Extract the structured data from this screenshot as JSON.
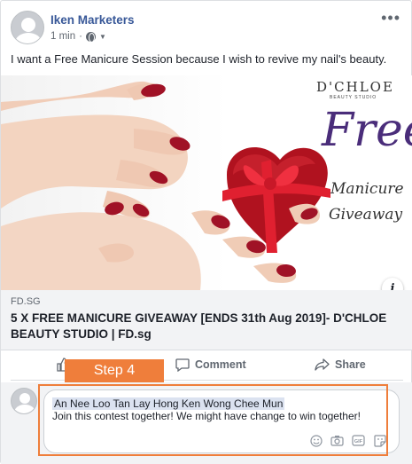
{
  "post": {
    "author": "Iken Marketers",
    "time": "1 min",
    "text": "I want a Free Manicure Session because I wish to revive my nail's beauty."
  },
  "image": {
    "brand": "D'CHLOE",
    "brand_sub": "BEAUTY STUDIO",
    "headline": "Free",
    "line1": "Manicure",
    "line2": "Giveaway",
    "info": "i"
  },
  "link": {
    "domain": "FD.SG",
    "title": "5 X FREE MANICURE GIVEAWAY [ENDS 31th Aug 2019]- D'CHLOE BEAUTY STUDIO | FD.sg"
  },
  "actions": {
    "like": "",
    "comment": "Comment",
    "share": "Share"
  },
  "annotation": {
    "step": "Step 4"
  },
  "comment": {
    "mentions": "An Nee Loo Tan Lay Hong Ken Wong Chee Mun",
    "text": "Join this contest together! We might have change to win together!"
  },
  "colors": {
    "author_link": "#385898",
    "accent_orange": "#ef7e3b",
    "headline_purple": "#4a2d7a",
    "nail_red": "#a01226"
  },
  "icons": [
    "more-icon",
    "globe-icon",
    "like-icon",
    "comment-icon",
    "share-icon",
    "emoji-icon",
    "camera-icon",
    "gif-icon",
    "sticker-icon"
  ]
}
